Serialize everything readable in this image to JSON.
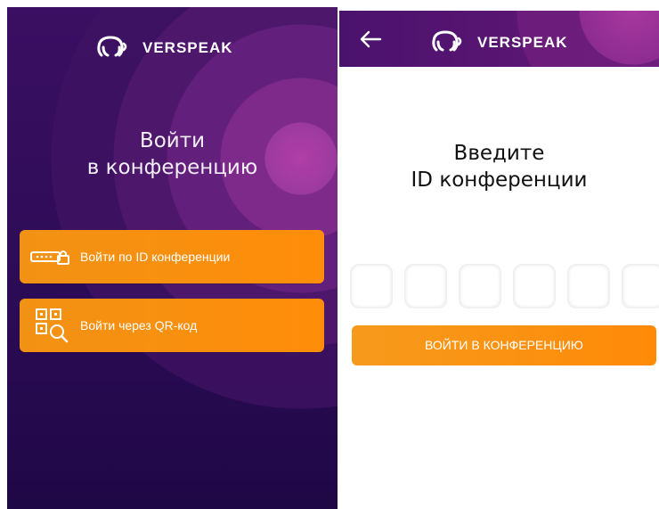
{
  "colors": {
    "accent_orange": "#ff8d0a",
    "bg_purple": "#2c0a53"
  },
  "left_screen": {
    "logo": {
      "icon": "headset-logo-icon",
      "brand": "VERSPEAK"
    },
    "title_line1": "Войти",
    "title_line2": "в конференцию",
    "buttons": [
      {
        "icon": "keyboard-lock-icon",
        "label": "Войти по ID конференции"
      },
      {
        "icon": "qr-search-icon",
        "label": "Войти через QR-код"
      }
    ]
  },
  "right_screen": {
    "back_icon": "arrow-left-icon",
    "logo": {
      "icon": "headset-logo-icon",
      "brand": "VERSPEAK"
    },
    "prompt_line1": "Введите",
    "prompt_line2": "ID конференции",
    "id_inputs": [
      "",
      "",
      "",
      "",
      "",
      ""
    ],
    "submit_label": "ВОЙТИ В КОНФЕРЕНЦИЮ"
  }
}
